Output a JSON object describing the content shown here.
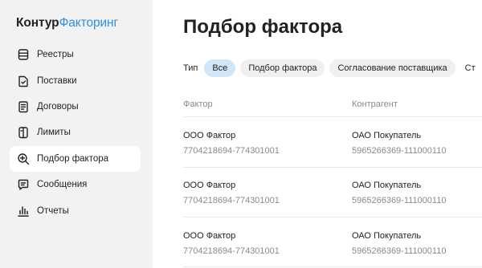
{
  "sidebar": {
    "logo": {
      "brand": "Контур",
      "product": "Факторинг"
    },
    "items": [
      {
        "label": "Реестры",
        "icon": "registry-icon",
        "active": false
      },
      {
        "label": "Поставки",
        "icon": "document-icon",
        "active": false
      },
      {
        "label": "Договоры",
        "icon": "contract-icon",
        "active": false
      },
      {
        "label": "Лимиты",
        "icon": "limits-icon",
        "active": false
      },
      {
        "label": "Подбор фактора",
        "icon": "search-plus-icon",
        "active": true
      },
      {
        "label": "Сообщения",
        "icon": "message-icon",
        "active": false
      },
      {
        "label": "Отчеты",
        "icon": "bar-chart-icon",
        "active": false
      }
    ]
  },
  "main": {
    "title": "Подбор фактора",
    "filter": {
      "label": "Тип",
      "chips": [
        {
          "label": "Все",
          "active": true
        },
        {
          "label": "Подбор фактора",
          "active": false
        },
        {
          "label": "Согласование поставщика",
          "active": false
        }
      ],
      "overflow": "Ст"
    },
    "table": {
      "columns": [
        "Фактор",
        "Контрагент"
      ],
      "rows": [
        {
          "factor_name": "ООО Фактор",
          "factor_inn": "7704218694-774301001",
          "counterparty_name": "ОАО Покупатель",
          "counterparty_inn": "5965266369-111000110"
        },
        {
          "factor_name": "ООО Фактор",
          "factor_inn": "7704218694-774301001",
          "counterparty_name": "ОАО Покупатель",
          "counterparty_inn": "5965266369-111000110"
        },
        {
          "factor_name": "ООО Фактор",
          "factor_inn": "7704218694-774301001",
          "counterparty_name": "ОАО Покупатель",
          "counterparty_inn": "5965266369-111000110"
        }
      ]
    }
  },
  "colors": {
    "brand_blue": "#2b8fe0",
    "active_chip": "#cfe7f9",
    "sidebar_bg": "#f2f2f2",
    "muted_text": "#8a8a8a"
  }
}
